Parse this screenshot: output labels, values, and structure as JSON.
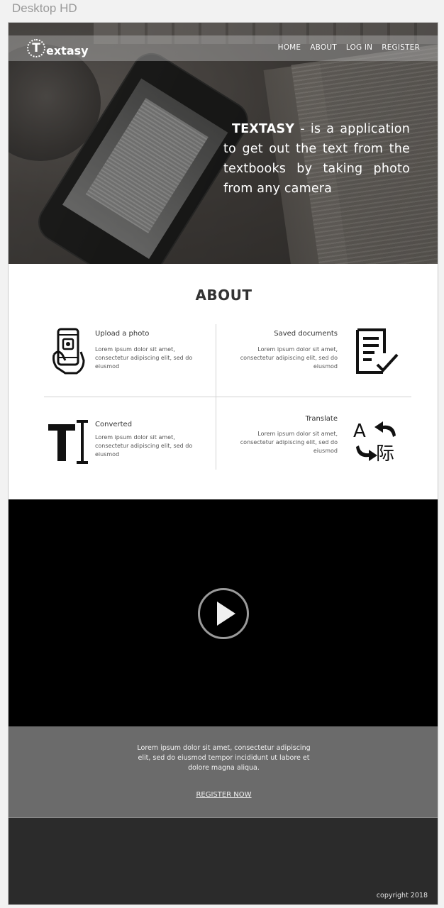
{
  "artboard_label": "Desktop HD",
  "logo": {
    "mark": "T",
    "text": "extasy"
  },
  "nav": [
    "HOME",
    "ABOUT",
    "LOG IN",
    "REGISTER"
  ],
  "hero": {
    "brand": "TEXTASY",
    "text": " - is a application to get out the text from the textbooks by taking photo from any camera"
  },
  "about": {
    "title": "ABOUT",
    "features": [
      {
        "title": "Upload a photo",
        "desc": "Lorem ipsum dolor sit amet, consectetur adipiscing elit, sed do eiusmod",
        "icon": "phone-hand-icon"
      },
      {
        "title": "Saved documents",
        "desc": "Lorem ipsum dolor sit amet, consectetur adipiscing elit, sed do eiusmod",
        "icon": "document-check-icon"
      },
      {
        "title": "Converted",
        "desc": "Lorem ipsum dolor sit amet, consectetur adipiscing elit, sed do eiusmod",
        "icon": "text-cursor-icon"
      },
      {
        "title": "Translate",
        "desc": "Lorem ipsum dolor sit amet, consectetur adipiscing elit, sed do eiusmod",
        "icon": "translate-icon"
      }
    ],
    "translate_glyphs": {
      "latin": "A",
      "cjk": "际"
    }
  },
  "video": {
    "icon": "play-icon"
  },
  "cta": {
    "text": "Lorem ipsum dolor sit amet, consectetur adipiscing elit, sed do eiusmod tempor incididunt ut labore et dolore magna aliqua.",
    "link": "REGISTER NOW"
  },
  "footer": {
    "copyright": "copyright 2018"
  }
}
